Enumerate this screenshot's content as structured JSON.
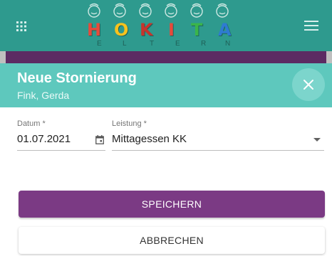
{
  "app": {
    "logo_text": "HOKITA",
    "logo_letters": [
      "H",
      "O",
      "K",
      "I",
      "T",
      "A"
    ],
    "logo_letter_colors": [
      "#e64a3b",
      "#f7c21d",
      "#3bb54a",
      "#e64a3b",
      "#2e7bd1",
      "#f7c21d"
    ],
    "logo_sub_letters": [
      "E",
      "L",
      "T",
      "E",
      "R",
      "N"
    ],
    "colors": {
      "teal": "#2e9a8e",
      "header": "#5ec8bd",
      "purple": "#7b3a84"
    },
    "icons": {
      "left": "apps-grid-icon",
      "right": "hamburger-menu-icon"
    }
  },
  "dialog": {
    "title": "Neue Stornierung",
    "subtitle": "Fink, Gerda",
    "close_icon": "close-icon",
    "fields": {
      "datum": {
        "label": "Datum *",
        "value": "01.07.2021",
        "icon": "calendar-icon"
      },
      "leistung": {
        "label": "Leistung *",
        "value": "Mittagessen KK",
        "icon": "dropdown-arrow-icon"
      }
    },
    "buttons": {
      "save": "SPEICHERN",
      "cancel": "ABBRECHEN"
    }
  }
}
